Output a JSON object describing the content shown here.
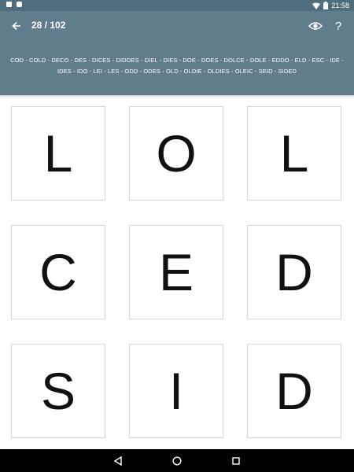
{
  "status_bar": {
    "time": "21:58"
  },
  "toolbar": {
    "counter": "28 / 102",
    "back_icon": "arrow-left-icon",
    "reveal_icon": "eye-icon",
    "help_label": "?"
  },
  "words": "COD - COLD - DECO - DES - DICES - DIDOES - DIEL - DIES - DOE - DOES - DOLCE - DOLE - EDDO - ELD - ESC - IDE - IDES - IDO - LEI - LES - ODD - ODES - OLD - OLDIE - OLDIES - OLEIC - SEID - SIDED",
  "grid": {
    "rows": [
      [
        "L",
        "O",
        "L"
      ],
      [
        "C",
        "E",
        "D"
      ],
      [
        "S",
        "I",
        "D"
      ]
    ]
  },
  "nav_bar": {
    "back_icon": "triangle-back-icon",
    "home_icon": "circle-home-icon",
    "recents_icon": "square-recents-icon"
  }
}
